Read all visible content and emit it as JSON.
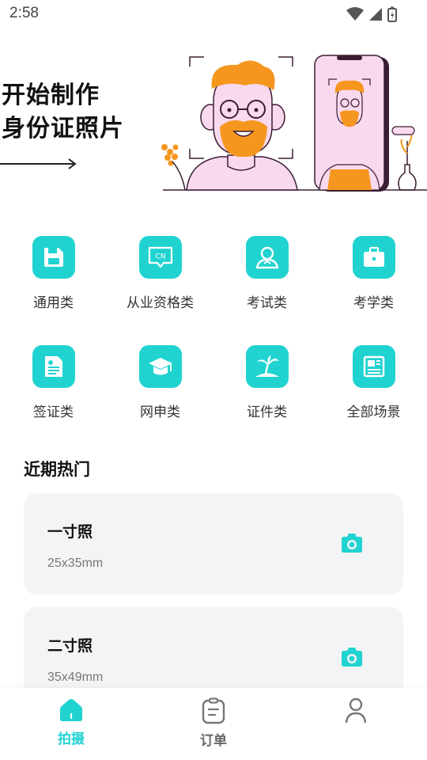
{
  "status_bar": {
    "time": "2:58"
  },
  "hero": {
    "title_line1": "开始制作",
    "title_line2": "身份证照片"
  },
  "colors": {
    "accent": "#21d3d0",
    "orange": "#f5961e",
    "pink": "#f9d9ee",
    "dark": "#3b1e33"
  },
  "categories": [
    {
      "label": "通用类",
      "icon": "floppy-disk-icon"
    },
    {
      "label": "从业资格类",
      "icon": "cn-chat-icon"
    },
    {
      "label": "考试类",
      "icon": "person-icon"
    },
    {
      "label": "考学类",
      "icon": "briefcase-icon"
    },
    {
      "label": "签证类",
      "icon": "document-icon"
    },
    {
      "label": "网申类",
      "icon": "graduation-cap-icon"
    },
    {
      "label": "证件类",
      "icon": "palm-island-icon"
    },
    {
      "label": "全部场景",
      "icon": "layout-grid-icon"
    }
  ],
  "cn_badge": "CN",
  "recent": {
    "title": "近期热门",
    "items": [
      {
        "name": "一寸照",
        "size": "25x35mm"
      },
      {
        "name": "二寸照",
        "size": "35x49mm"
      }
    ]
  },
  "tabbar": {
    "tabs": [
      {
        "label": "拍摄",
        "icon": "home-icon",
        "active": true
      },
      {
        "label": "订单",
        "icon": "clipboard-icon",
        "active": false
      },
      {
        "label": "",
        "icon": "profile-icon",
        "active": false
      }
    ]
  }
}
